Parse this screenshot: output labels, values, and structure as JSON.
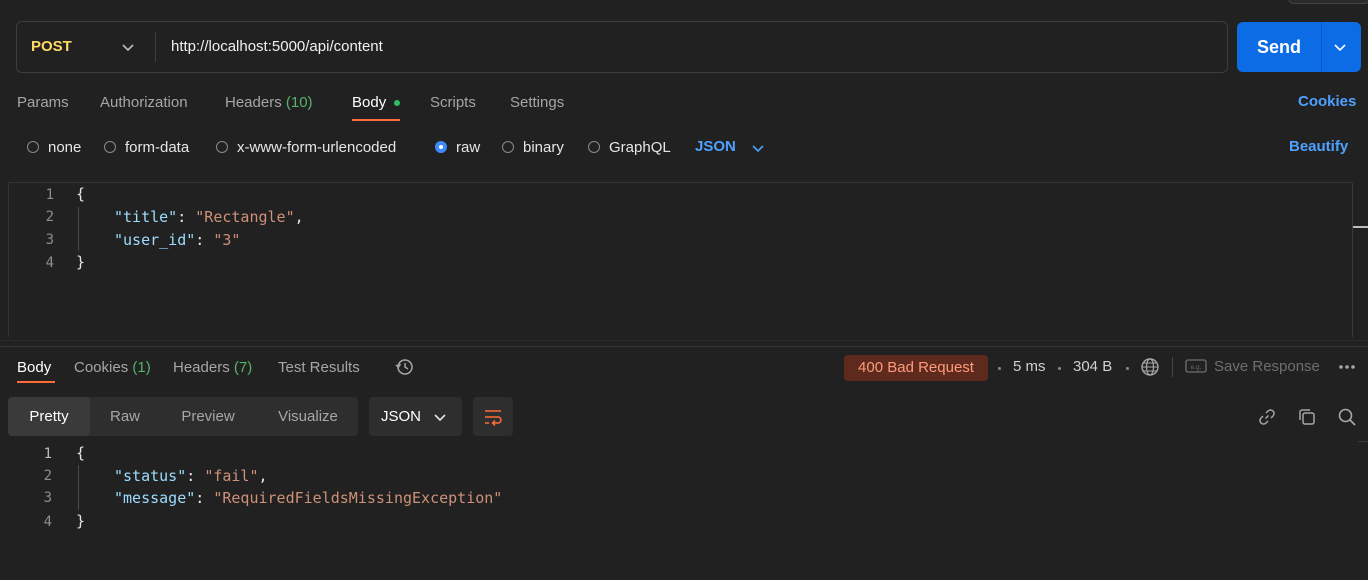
{
  "request": {
    "method": "POST",
    "url": "http://localhost:5000/api/content",
    "send_label": "Send"
  },
  "request_tabs": {
    "params": "Params",
    "authorization": "Authorization",
    "headers": "Headers",
    "headers_count": "(10)",
    "body": "Body",
    "scripts": "Scripts",
    "settings": "Settings",
    "cookies": "Cookies"
  },
  "body_types": {
    "none": "none",
    "form_data": "form-data",
    "urlencoded": "x-www-form-urlencoded",
    "raw": "raw",
    "binary": "binary",
    "graphql": "GraphQL",
    "selected": "raw",
    "format": "JSON",
    "beautify": "Beautify"
  },
  "request_body": {
    "line_numbers": [
      "1",
      "2",
      "3",
      "4"
    ],
    "open_brace": "{",
    "close_brace": "}",
    "fields": [
      {
        "key": "\"title\"",
        "value": "\"Rectangle\"",
        "trail": ","
      },
      {
        "key": "\"user_id\"",
        "value": "\"3\"",
        "trail": ""
      }
    ]
  },
  "response_tabs": {
    "body": "Body",
    "cookies": "Cookies",
    "cookies_count": "(1)",
    "headers": "Headers",
    "headers_count": "(7)",
    "test_results": "Test Results"
  },
  "response_meta": {
    "status": "400 Bad Request",
    "time": "5 ms",
    "size": "304 B",
    "save_response": "Save Response"
  },
  "response_view": {
    "pretty": "Pretty",
    "raw": "Raw",
    "preview": "Preview",
    "visualize": "Visualize",
    "format": "JSON"
  },
  "response_body": {
    "line_numbers": [
      "1",
      "2",
      "3",
      "4"
    ],
    "open_brace": "{",
    "close_brace": "}",
    "fields": [
      {
        "key": "\"status\"",
        "value": "\"fail\"",
        "trail": ","
      },
      {
        "key": "\"message\"",
        "value": "\"RequiredFieldsMissingException\"",
        "trail": ""
      }
    ]
  },
  "colors": {
    "background": "#212121",
    "accent_orange": "#ff6c37",
    "send_blue": "#0b6ce6",
    "link_blue": "#4ea1ff",
    "method_yellow": "#ffd966",
    "error_badge": "#5e2a1d",
    "count_green": "#58b36a"
  },
  "icons": [
    "chevron-down-icon",
    "history-icon",
    "globe-icon",
    "save-response-icon",
    "more-icon",
    "wrap-lines-icon",
    "link-icon",
    "copy-icon",
    "search-icon"
  ]
}
